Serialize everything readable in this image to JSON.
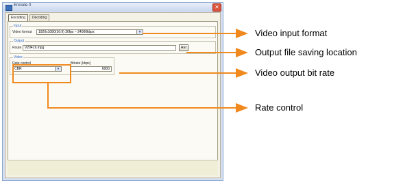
{
  "window": {
    "title": "Encode 0",
    "close_glyph": "✕",
    "app_icon": "app-icon",
    "close_icon": "close-icon"
  },
  "tabs": [
    {
      "label": "Encoding",
      "active": true
    },
    {
      "label": "Decoding",
      "active": false
    }
  ],
  "input": {
    "group_label": "Input",
    "video_format_label": "Video format",
    "video_format_value": "1920x1080(16:9)  30fps ~ 24000kbps",
    "dropdown_glyph": "▾"
  },
  "output": {
    "group_label": "Output",
    "route_label": "Route",
    "route_value": "V20419.mpg",
    "ref_button": "Ref"
  },
  "video": {
    "group_label": "Video",
    "rate_control_label": "Rate control",
    "rate_control_value": "CBR",
    "bitrate_label": "Bitrate [kbps]",
    "bitrate_value": "6000",
    "dropdown_glyph": "▾"
  },
  "annotations": {
    "video_input_format": "Video input format",
    "output_file_location": "Output file saving location",
    "video_output_bit_rate": "Video output bit rate",
    "rate_control": "Rate control"
  },
  "colors": {
    "annotation_orange": "#f0891e",
    "tab_group_blue": "#2b63c4"
  }
}
